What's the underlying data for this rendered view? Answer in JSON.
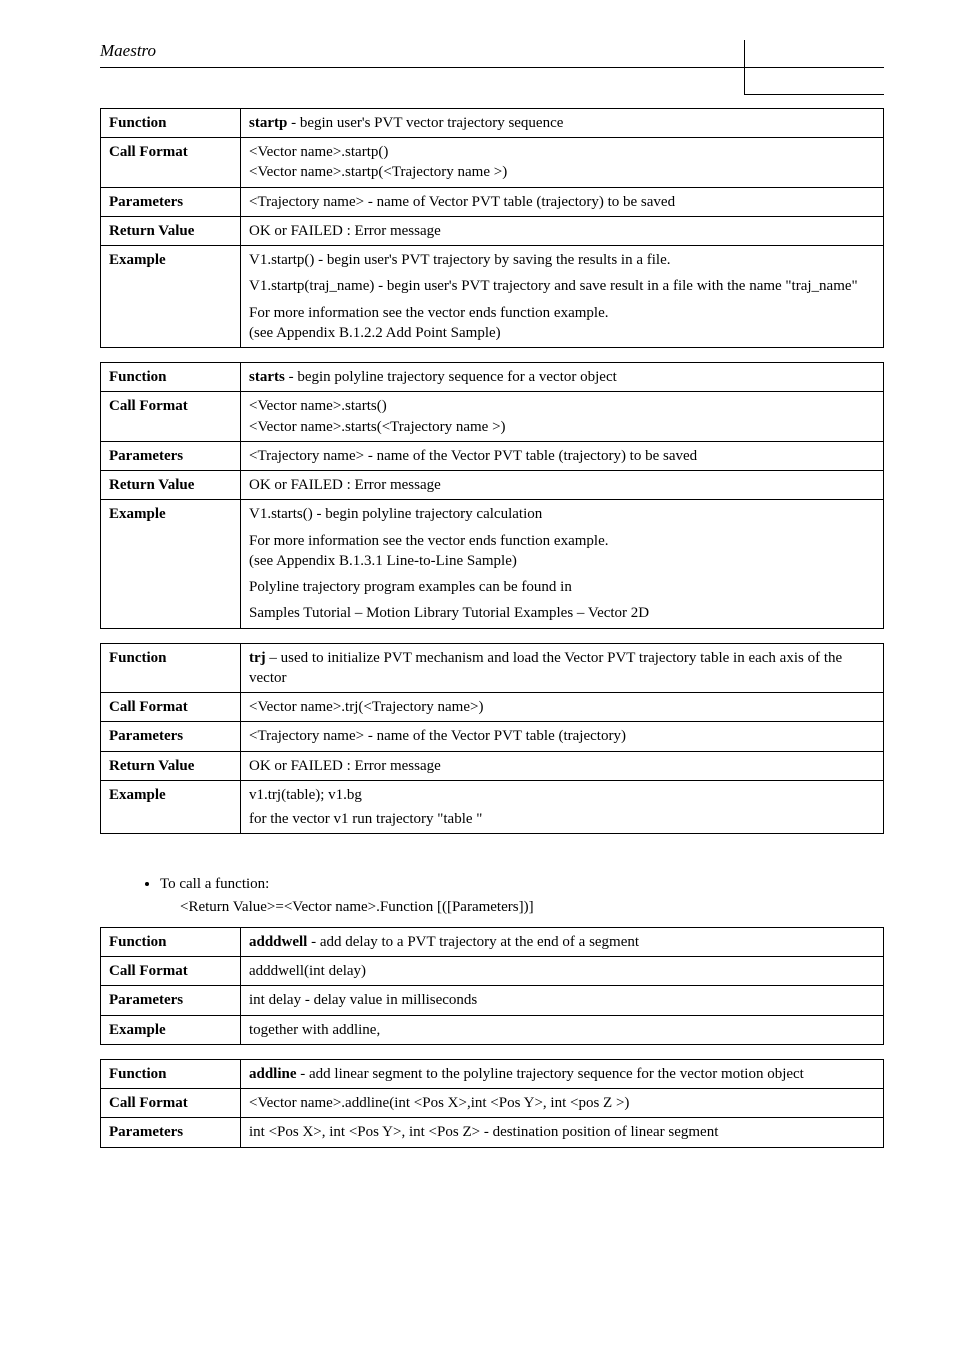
{
  "header": {
    "title": "Maestro"
  },
  "tables": {
    "startp": {
      "function_label": "Function",
      "function_name": "startp",
      "function_desc": " - begin user's PVT vector trajectory sequence",
      "callformat_label": "Call Format",
      "callformat_l1": "<Vector name>.startp()",
      "callformat_l2": "<Vector name>.startp(<Trajectory name >)",
      "parameters_label": "Parameters",
      "parameters_val": "<Trajectory name> - name of Vector PVT table (trajectory) to be saved",
      "return_label": "Return Value",
      "return_val": "OK     or     FAILED : Error message",
      "example_label": "Example",
      "example_l1": "V1.startp() - begin user's PVT trajectory by saving the results in a file.",
      "example_l2": "V1.startp(traj_name) - begin user's PVT trajectory and  save result in a file with the name  \"traj_name\"",
      "example_l3": "For more information see the vector ends function example.",
      "example_l4": "(see Appendix  B.1.2.2 Add Point Sample)"
    },
    "starts": {
      "function_label": "Function",
      "function_name": "starts",
      "function_desc": " - begin polyline trajectory sequence for a vector object",
      "callformat_label": "Call Format",
      "callformat_l1": "<Vector name>.starts()",
      "callformat_l2": "<Vector name>.starts(<Trajectory name >)",
      "parameters_label": "Parameters",
      "parameters_val": "<Trajectory name> - name of the Vector PVT table (trajectory) to be saved",
      "return_label": "Return Value",
      "return_val": "OK     or     FAILED : Error message",
      "example_label": "Example",
      "example_l1": "V1.starts() - begin polyline trajectory calculation",
      "example_l2": "For more information see the vector ends function example.",
      "example_l3": "(see Appendix B.1.3.1 Line-to-Line Sample)",
      "example_l4": "Polyline trajectory  program examples can be found in",
      "example_l5": "Samples Tutorial – Motion Library Tutorial Examples – Vector 2D"
    },
    "trj": {
      "function_label": "Function",
      "function_name": "trj",
      "function_desc": " – used to initialize PVT mechanism and load the Vector PVT trajectory table in each axis of the vector",
      "callformat_label": "Call Format",
      "callformat_val": "<Vector name>.trj(<Trajectory name>)",
      "parameters_label": "Parameters",
      "parameters_val": "<Trajectory name> - name of the Vector PVT table (trajectory)",
      "return_label": "Return Value",
      "return_val": "OK     or     FAILED : Error message",
      "example_label": "Example",
      "example_l1": "v1.trj(table); v1.bg",
      "example_l2": " for the vector v1 run trajectory  \"table \""
    },
    "adddwell": {
      "function_label": "Function",
      "function_name": "adddwell",
      "function_desc": " - add delay to a PVT trajectory at the end of a segment",
      "callformat_label": "Call Format",
      "callformat_val": "adddwell(int delay)",
      "parameters_label": "Parameters",
      "parameters_val": "int delay - delay value in milliseconds",
      "example_label": "Example",
      "example_val": "together with addline,"
    },
    "addline": {
      "function_label": "Function",
      "function_name": "addline",
      "function_desc": " - add linear segment to the polyline trajectory sequence for  the vector motion object",
      "callformat_label": "Call Format",
      "callformat_val": "<Vector name>.addline(int <Pos X>,int <Pos Y>, int <pos Z >)",
      "parameters_label": "Parameters",
      "parameters_val": "int <Pos X>, int  <Pos Y>, int <Pos Z> - destination position of linear segment"
    }
  },
  "bullet": {
    "line1": "To call a function:",
    "line2": "<Return Value>=<Vector name>.Function [([Parameters])]"
  }
}
